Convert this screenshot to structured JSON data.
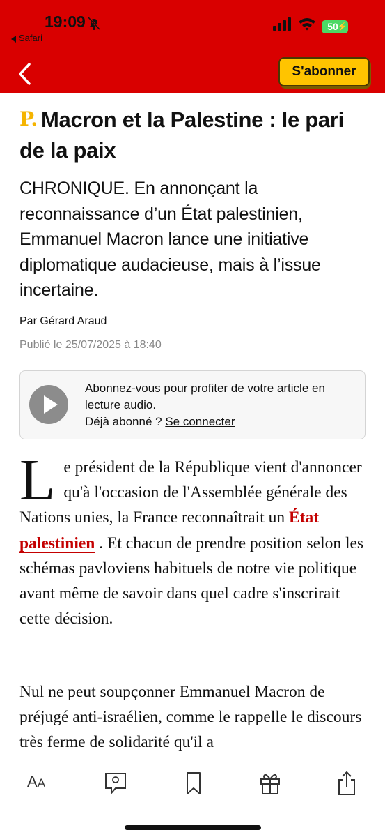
{
  "status_bar": {
    "time": "19:09",
    "back_app_label": "Safari",
    "battery": "50"
  },
  "header": {
    "subscribe_label": "S'abonner",
    "brand_color": "#d90000",
    "button_color": "#ffc400"
  },
  "article": {
    "logo": "P.",
    "title": "Macron et la Palestine : le pari de la paix",
    "chapo": "CHRONIQUE. En annonçant la reconnaissance d’un État palestinien, Emmanuel Macron lance une initiative diplomatique audacieuse, mais à l’issue incertaine.",
    "author": "Par Gérard Araud",
    "published": "Publié le 25/07/2025 à 18:40"
  },
  "audio": {
    "subscribe_link": "Abonnez-vous",
    "subscribe_text": " pour profiter de votre article en lecture audio.",
    "already_subscribed": "Déjà abonné ? ",
    "login_link": "Se connecter"
  },
  "body": {
    "dropcap": "L",
    "para1_start": "e président de la République vient d'annoncer qu'à l'occasion de l'As­semblée générale des Nations unies, la France reconnaîtrait un ",
    "para1_link": "État palestinien",
    "para1_end": " . Et chacun de prendre position selon les schémas pavloviens habituels de notre vie politique avant même de savoir dans quel cadre s'inscrirait cette décision.",
    "para2": "Nul ne peut soupçonner Emmanuel Ma­cron de préjugé anti-israélien, comme le rappelle le discours très ferme de solidarité qu'il a"
  },
  "toolbar": {
    "text_size_big": "A",
    "text_size_small": "A",
    "icons": [
      "text-size-icon",
      "comment-icon",
      "bookmark-icon",
      "gift-icon",
      "share-icon"
    ]
  }
}
